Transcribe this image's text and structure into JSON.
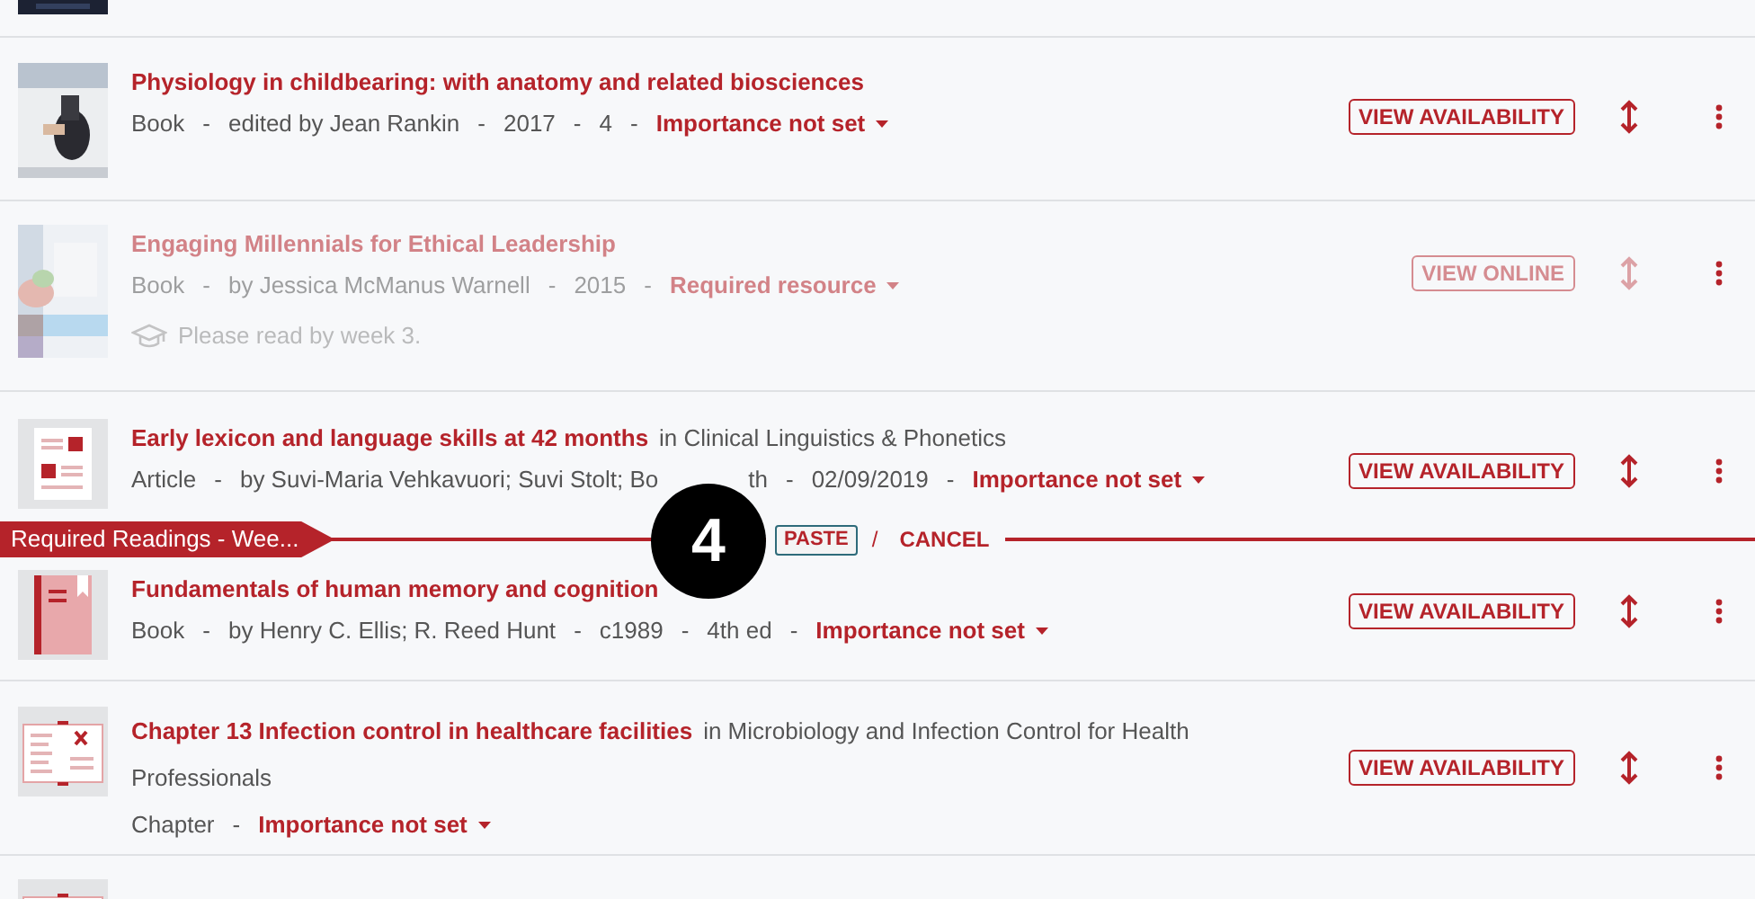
{
  "items": [
    {
      "kind": "cover_stub"
    },
    {
      "kind": "cover",
      "faded": false,
      "title": "Physiology in childbearing: with anatomy and related biosciences",
      "meta": [
        "Book",
        "edited by Jean Rankin",
        "2017",
        "4"
      ],
      "separator": "-",
      "importance": "Importance not set",
      "action": "VIEW AVAILABILITY"
    },
    {
      "kind": "cover",
      "faded": true,
      "title": "Engaging Millennials for Ethical Leadership",
      "meta": [
        "Book",
        "by Jessica McManus Warnell",
        "2015"
      ],
      "separator": "-",
      "importance": "Required resource",
      "note": "Please read by week 3.",
      "action": "VIEW ONLINE"
    },
    {
      "kind": "article",
      "faded": false,
      "title": "Early lexicon and language skills at 42 months",
      "container": "in Clinical Linguistics & Phonetics",
      "meta": [
        "Article",
        [
          "by Suvi-Maria Vehkavuori; Suvi Stolt; Bo",
          "th"
        ],
        "02/09/2019"
      ],
      "separator": "-",
      "importance": "Importance not set",
      "action": "VIEW AVAILABILITY"
    },
    {
      "kind": "paste_bar",
      "section": "Required Readings - Wee...",
      "step": "4",
      "paste": "PASTE",
      "separator": "/",
      "cancel": "CANCEL"
    },
    {
      "kind": "book",
      "faded": false,
      "title": "Fundamentals of human memory and cognition",
      "meta": [
        "Book",
        "by Henry C. Ellis; R. Reed Hunt",
        "c1989",
        "4th ed"
      ],
      "separator": "-",
      "importance": "Importance not set",
      "action": "VIEW AVAILABILITY"
    },
    {
      "kind": "chapter",
      "faded": false,
      "title": "Chapter 13 Infection control in healthcare facilities",
      "container": "in Microbiology and Infection Control for Health Professionals",
      "meta": [
        "Chapter"
      ],
      "separator": "-",
      "importance": "Importance not set",
      "action": "VIEW AVAILABILITY"
    },
    {
      "kind": "chapter_stub"
    }
  ]
}
